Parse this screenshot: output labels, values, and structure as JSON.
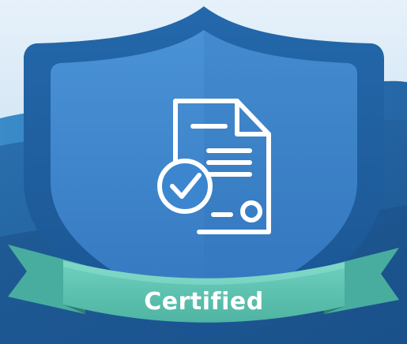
{
  "badge": {
    "ribbon_label": "Certified",
    "icon": "certificate-document-check-icon"
  },
  "colors": {
    "sky_top": "#e3eff9",
    "sky_bottom": "#bcd8ee",
    "wave_dark": "#1f5d99",
    "wave_mid": "#2d78b8",
    "shield_outer": "#1f5e9e",
    "shield_inner": "#3c86cf",
    "icon_stroke": "#ffffff",
    "ribbon_front": "#5cc2b0",
    "ribbon_back": "#3a9a8c",
    "ribbon_shadow": "#2e7f75"
  }
}
